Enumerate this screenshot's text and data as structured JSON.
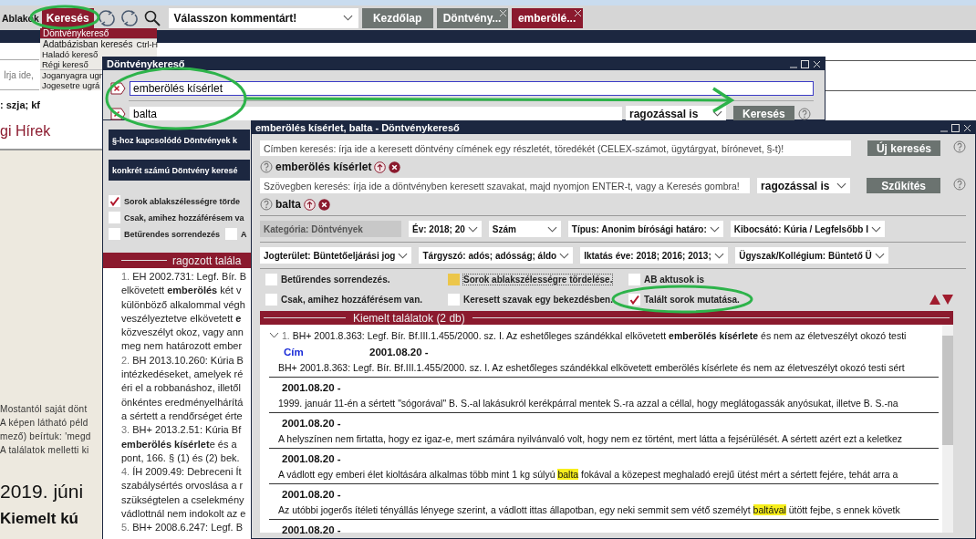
{
  "app": {
    "menu_label": "Ablakok",
    "search_menu": "Keresés",
    "combo": {
      "value": "Válasszon kommentárt!"
    },
    "tabs": [
      {
        "label": "Kezdőlap",
        "selected": false,
        "closable": false
      },
      {
        "label": "Döntvény...",
        "selected": false,
        "closable": true
      },
      {
        "label": "emberölé...",
        "selected": true,
        "closable": true
      }
    ]
  },
  "menu": {
    "groups": [
      [
        {
          "label": "Döntvénykereső",
          "selected": true
        }
      ],
      [
        {
          "label": "Adatbázisban keresés",
          "shortcut": "Ctrl-H",
          "selected": false
        },
        {
          "label": "Haladó kereső",
          "selected": false
        },
        {
          "label": "Régi kereső",
          "selected": false
        }
      ],
      [
        {
          "label": "Joganyagra ugr",
          "selected": false
        },
        {
          "label": "Jogesetre ugrá",
          "selected": false
        }
      ]
    ]
  },
  "background": {
    "search": {
      "placeholder": "Írja ide,"
    },
    "tags_line": ": szja; kf",
    "news_heading": "gi Hírek",
    "paragraph_lines": [
      "Mostantól saját dönt",
      "A képen látható péld",
      "mező) beírtuk: 'megd",
      "A találatok melletti ki"
    ],
    "date_heading": "2019. júni",
    "subheading": "Kiemelt kú"
  },
  "window1": {
    "title": "Döntvénykereső",
    "terms": [
      {
        "value": "emberölés kísérlet",
        "focused": true
      },
      {
        "value": "balta",
        "focused": false
      }
    ],
    "mode": "ragozással is",
    "search_button": "Keresés",
    "buttons": [
      "§-hoz kapcsolódó Döntvények k",
      "konkrét számú Döntvény keresé"
    ],
    "option_rows": [
      [
        {
          "label": "Sorok ablakszélességre törde",
          "checked": true
        }
      ],
      [
        {
          "label": "Csak, amihez hozzáférésem va",
          "checked": false
        }
      ],
      [
        {
          "label": "Betűrendes sorrendezés",
          "checked": false
        },
        {
          "label": "A",
          "checked": false
        }
      ]
    ],
    "results": {
      "title": "ragozott talála",
      "lines": [
        {
          "number": "1.",
          "text": "EH 2002.731: Legf. Bír. B"
        },
        {
          "text": "elkövetett **emberölés** két v"
        },
        {
          "text": "különböző alkalommal végh"
        },
        {
          "text": "veszélyeztetve elkövetett **e**"
        },
        {
          "text": "közveszélyt okoz, vagy ann"
        },
        {
          "text": "meg nem határozott ember"
        },
        {
          "number": "2.",
          "text": "BH 2013.10.260: Kúria B"
        },
        {
          "text": "intézkedéseket, amelyek ré"
        },
        {
          "text": "éri el a robbanáshoz, illetől"
        },
        {
          "text": "önkéntes eredményelhárítá"
        },
        {
          "text": "a sértett a rendőrséget érte"
        },
        {
          "number": "3.",
          "text": "BH+ 2013.2.51: Kúria Bf"
        },
        {
          "text": "**emberölés kísérlet**e és a"
        },
        {
          "text": "pont, 166. § (1) és (2) bek."
        },
        {
          "number": "4.",
          "text": "ÍH 2009.49: Debreceni Ít"
        },
        {
          "text": "szabálysértés orvoslása a r"
        },
        {
          "text": "szükségtelen a cselekmény"
        },
        {
          "text": "vádlottnál nem indokolt az e"
        },
        {
          "number": "5.",
          "text": "BH+ 2008.6.247: Legf. B"
        }
      ]
    }
  },
  "window2": {
    "title": "emberölés kísérlet, balta - Döntvénykereső",
    "title_search": {
      "placeholder": "Címben keresés: írja ide a keresett döntvény címének egy részletét, töredékét (CELEX-számot, ügytárgyat, bírónevet, §-t)!"
    },
    "new_search_button": "Új keresés",
    "title_terms": [
      "emberölés kísérlet"
    ],
    "text_search": {
      "placeholder": "Szövegben keresés: írja ide a döntvényben keresett szavakat, majd nyomjon ENTER-t, vagy a Keresés gombra!"
    },
    "mode": "ragozással is",
    "narrow_button": "Szűkítés",
    "text_terms": [
      "balta"
    ],
    "filter_rows": [
      [
        {
          "label": "Kategória: Döntvények",
          "disabled": true
        },
        {
          "label": "Év: 2018; 20",
          "disabled": false
        },
        {
          "label": "Szám",
          "disabled": false
        },
        {
          "label": "Típus: Anonim bírósági határo:",
          "disabled": false
        },
        {
          "label": "Kibocsátó: Kúria / Legfelsőbb I",
          "disabled": false
        }
      ],
      [
        {
          "label": "Jogterület: Büntetőeljárási jog",
          "disabled": false
        },
        {
          "label": "Tárgyszó: adós; adósság; áldo",
          "disabled": false
        },
        {
          "label": "Iktatás éve: 2018; 2016; 2013;",
          "disabled": false
        },
        {
          "label": "Ügyszak/Kollégium: Büntető Ü",
          "disabled": false
        }
      ]
    ],
    "options": [
      {
        "label": "Betűrendes sorrendezés.",
        "checked": false,
        "focused": false
      },
      {
        "label": "Sorok ablakszélességre tördelése.",
        "checked": false,
        "focused": true
      },
      {
        "label": "AB aktusok is",
        "checked": false,
        "focused": false
      },
      {
        "label": "Csak, amihez hozzáférésem van.",
        "checked": false,
        "focused": false
      },
      {
        "label": "Keresett szavak egy bekezdésben.",
        "checked": false,
        "focused": false
      },
      {
        "label": "Talált sorok mutatása.",
        "checked": true,
        "focused": false
      }
    ],
    "results": {
      "title": "Kiemelt találatok (2 db)",
      "items": [
        {
          "expanded": true,
          "number": "1.",
          "heading": "BH+ 2001.8.363: Legf. Bír. Bf.III.1.455/2000. sz. I. Az eshetőleges szándékkal elkövetett **emberölés kísérlete** és nem az életveszélyt okozó testi",
          "fields": [
            {
              "label": "Cím",
              "date": "2001.08.20 -",
              "text": "BH+ 2001.8.363: Legf. Bír. Bf.III.1.455/2000. sz. I. Az eshetőleges szándékkal elkövetett emberölés kísérlete és nem az életveszélyt okozó testi sért"
            }
          ],
          "snippets": [
            {
              "date": "2001.08.20 -",
              "parts": [
                {
                  "text": "1999. január 11-én a sértett \"sógorával\" B. S.-al lakásukról kerékpárral mentek S.-ra azzal a céllal, hogy meglátogassák anyósukat, illetve B. S.-na",
                  "highlight": false
                }
              ]
            },
            {
              "date": "2001.08.20 -",
              "parts": [
                {
                  "text": "A helyszínen nem firtatta, hogy ez igaz-e, mert számára nyilvánvaló volt, hogy nem ez történt, mert látta a fejsérülését. A sértett azért ezt a keletkez",
                  "highlight": false
                }
              ]
            },
            {
              "date": "2001.08.20 -",
              "parts": [
                {
                  "text": "A vádlott egy emberi élet kioltására alkalmas több mint 1 kg súlyú ",
                  "highlight": false
                },
                {
                  "text": "balta",
                  "highlight": true
                },
                {
                  "text": " fokával a közepest meghaladó erejű ütést mért a sértett fejére, tehát arra a",
                  "highlight": false
                }
              ]
            },
            {
              "date": "2001.08.20 -",
              "parts": [
                {
                  "text": "Az utóbbi jogerős ítéleti tényállás lényege szerint, a vádlott ittas állapotban, egy neki semmit sem vétő személyt ",
                  "highlight": false
                },
                {
                  "text": "baltával",
                  "highlight": true
                },
                {
                  "text": " ütött fejbe, s ennek követk",
                  "highlight": false
                }
              ]
            },
            {
              "date": "2001.08.20 -"
            }
          ]
        }
      ]
    }
  }
}
